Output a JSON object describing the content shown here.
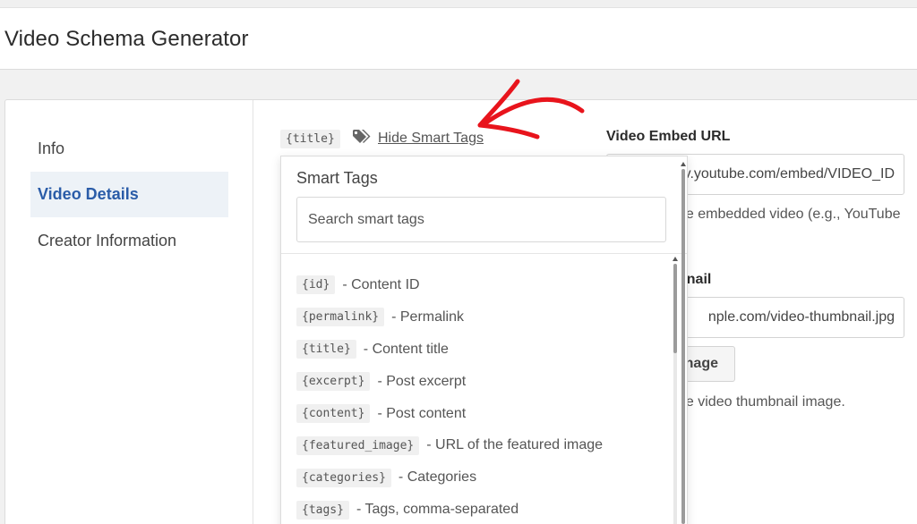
{
  "header": {
    "title": "Video Schema Generator"
  },
  "sidebar": {
    "items": [
      {
        "label": "Info",
        "active": false
      },
      {
        "label": "Video Details",
        "active": true
      },
      {
        "label": "Creator Information",
        "active": false
      }
    ]
  },
  "main": {
    "title_tag": "{title}",
    "hide_smart_tags_label": "Hide Smart Tags",
    "tag_icon": "tags-icon",
    "annotation_arrow_color": "#e8141c"
  },
  "embed_url": {
    "label": "Video Embed URL",
    "value": "v.youtube.com/embed/VIDEO_ID",
    "help": "he embedded video (e.g., YouTube"
  },
  "thumbnail": {
    "label": "bnail",
    "value": "nple.com/video-thumbnail.jpg",
    "button_label": "nage",
    "help": "he video thumbnail image."
  },
  "smart_tags": {
    "title": "Smart Tags",
    "search_placeholder": "Search smart tags",
    "items": [
      {
        "tag": "{id}",
        "desc": "- Content ID"
      },
      {
        "tag": "{permalink}",
        "desc": "- Permalink"
      },
      {
        "tag": "{title}",
        "desc": "- Content title"
      },
      {
        "tag": "{excerpt}",
        "desc": "- Post excerpt"
      },
      {
        "tag": "{content}",
        "desc": "- Post content"
      },
      {
        "tag": "{featured_image}",
        "desc": "- URL of the featured image"
      },
      {
        "tag": "{categories}",
        "desc": "- Categories"
      },
      {
        "tag": "{tags}",
        "desc": "- Tags, comma-separated"
      }
    ]
  }
}
